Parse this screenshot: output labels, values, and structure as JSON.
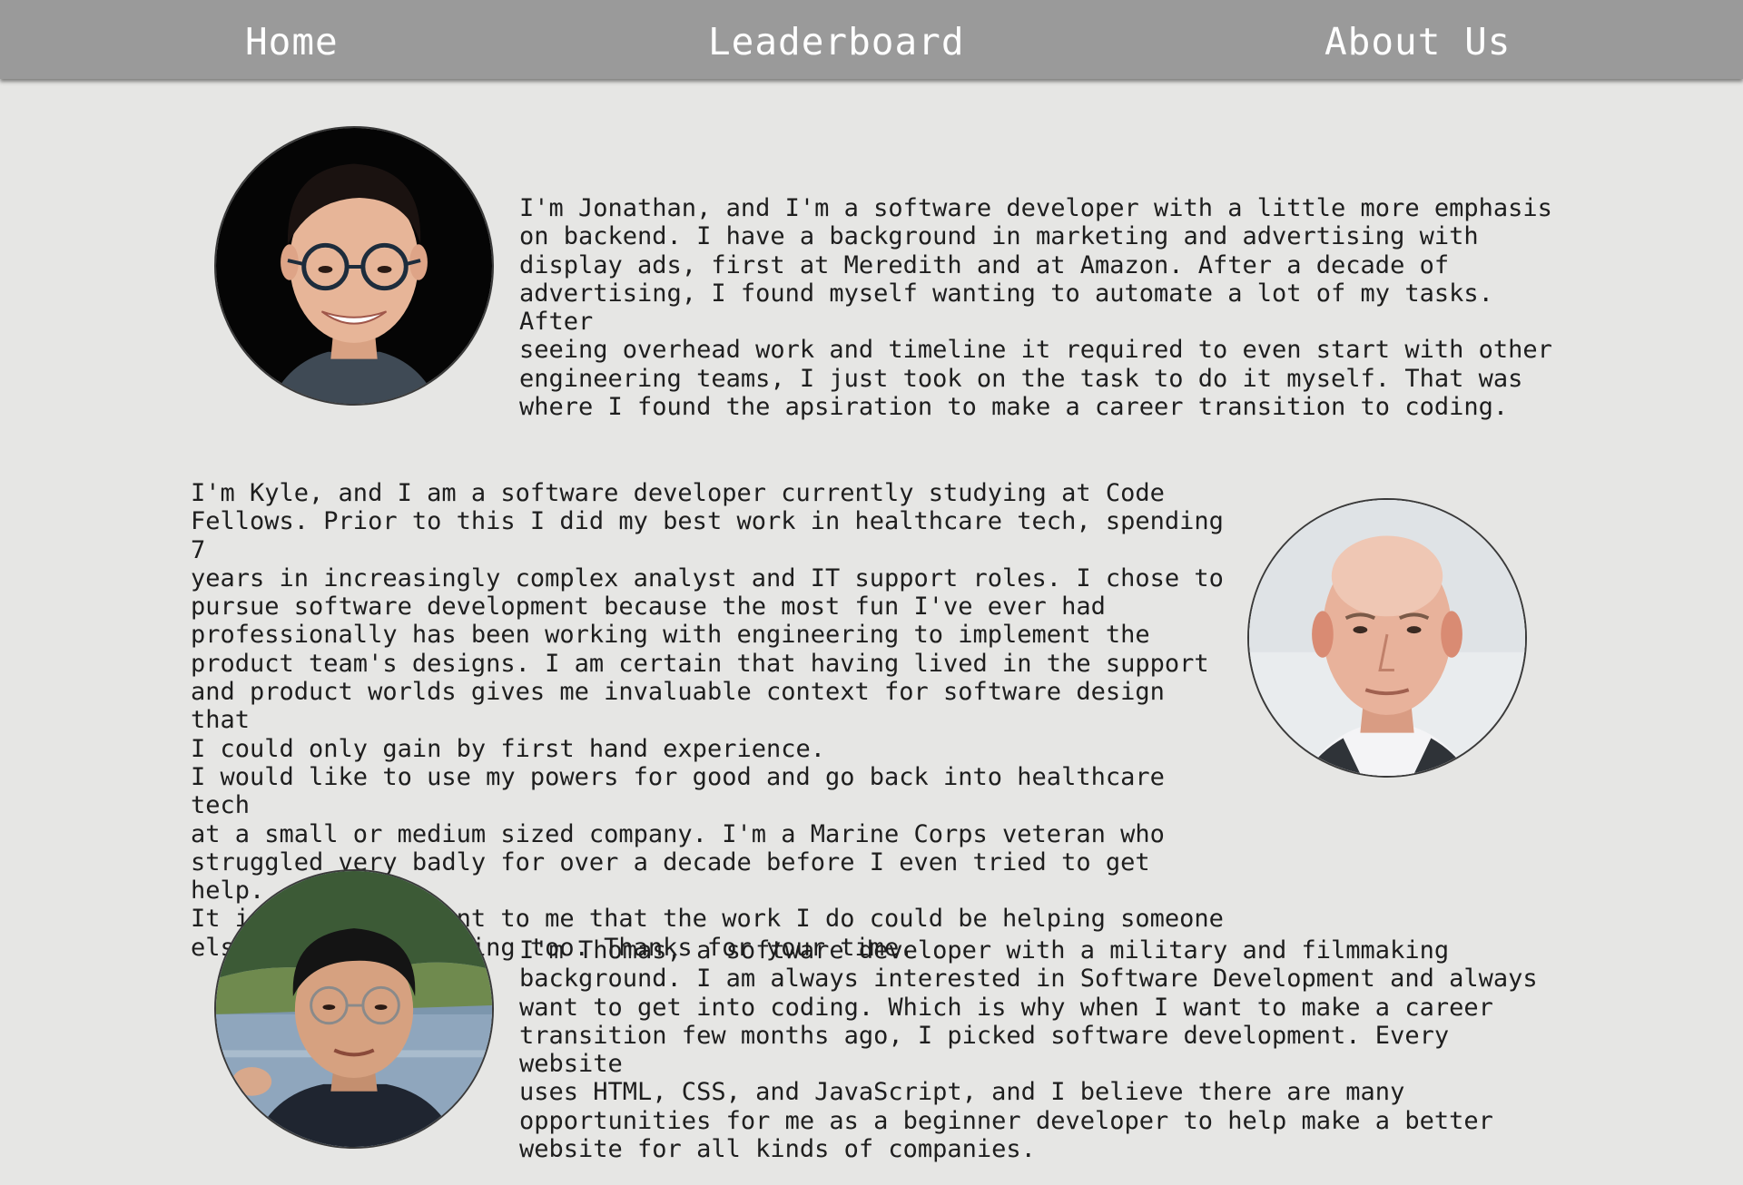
{
  "nav": {
    "home": "Home",
    "leaderboard": "Leaderboard",
    "about": "About Us"
  },
  "members": {
    "jonathan": {
      "bio": "I'm Jonathan, and I'm a software developer with a little more emphasis\non backend. I have a background in marketing and advertising with\ndisplay ads, first at Meredith and at Amazon. After a decade of\nadvertising, I found myself wanting to automate a lot of my tasks. After\nseeing overhead work and timeline it required to even start with other\nengineering teams, I just took on the task to do it myself. That was\nwhere I found the apsiration to make a career transition to coding."
    },
    "kyle": {
      "bio": "I'm Kyle, and I am a software developer currently studying at Code\nFellows. Prior to this I did my best work in healthcare tech, spending 7\nyears in increasingly complex analyst and IT support roles. I chose to\npursue software development because the most fun I've ever had\nprofessionally has been working with engineering to implement the\nproduct team's designs. I am certain that having lived in the support\nand product worlds gives me invaluable context for software design that\nI could only gain by first hand experience.\nI would like to use my powers for good and go back into healthcare tech\nat a small or medium sized company. I'm a Marine Corps veteran who\nstruggled very badly for over a decade before I even tried to get help.\nIt is very important to me that the work I do could be helping someone\nelse who is struggling too. Thanks for your time."
    },
    "thomas": {
      "bio": "I'm Thomas, a software developer with a military and filmmaking\nbackground. I am always interested in Software Development and always\nwant to get into coding. Which is why when I want to make a career\ntransition few months ago, I picked software development. Every website\nuses HTML, CSS, and JavaScript, and I believe there are many\nopportunities for me as a beginner developer to help make a better\nwebsite for all kinds of companies."
    }
  },
  "colors": {
    "page_bg": "#e6e6e4",
    "nav_bg": "#9a9a9a",
    "nav_text": "#ffffff",
    "body_text": "#1e1e1e"
  }
}
